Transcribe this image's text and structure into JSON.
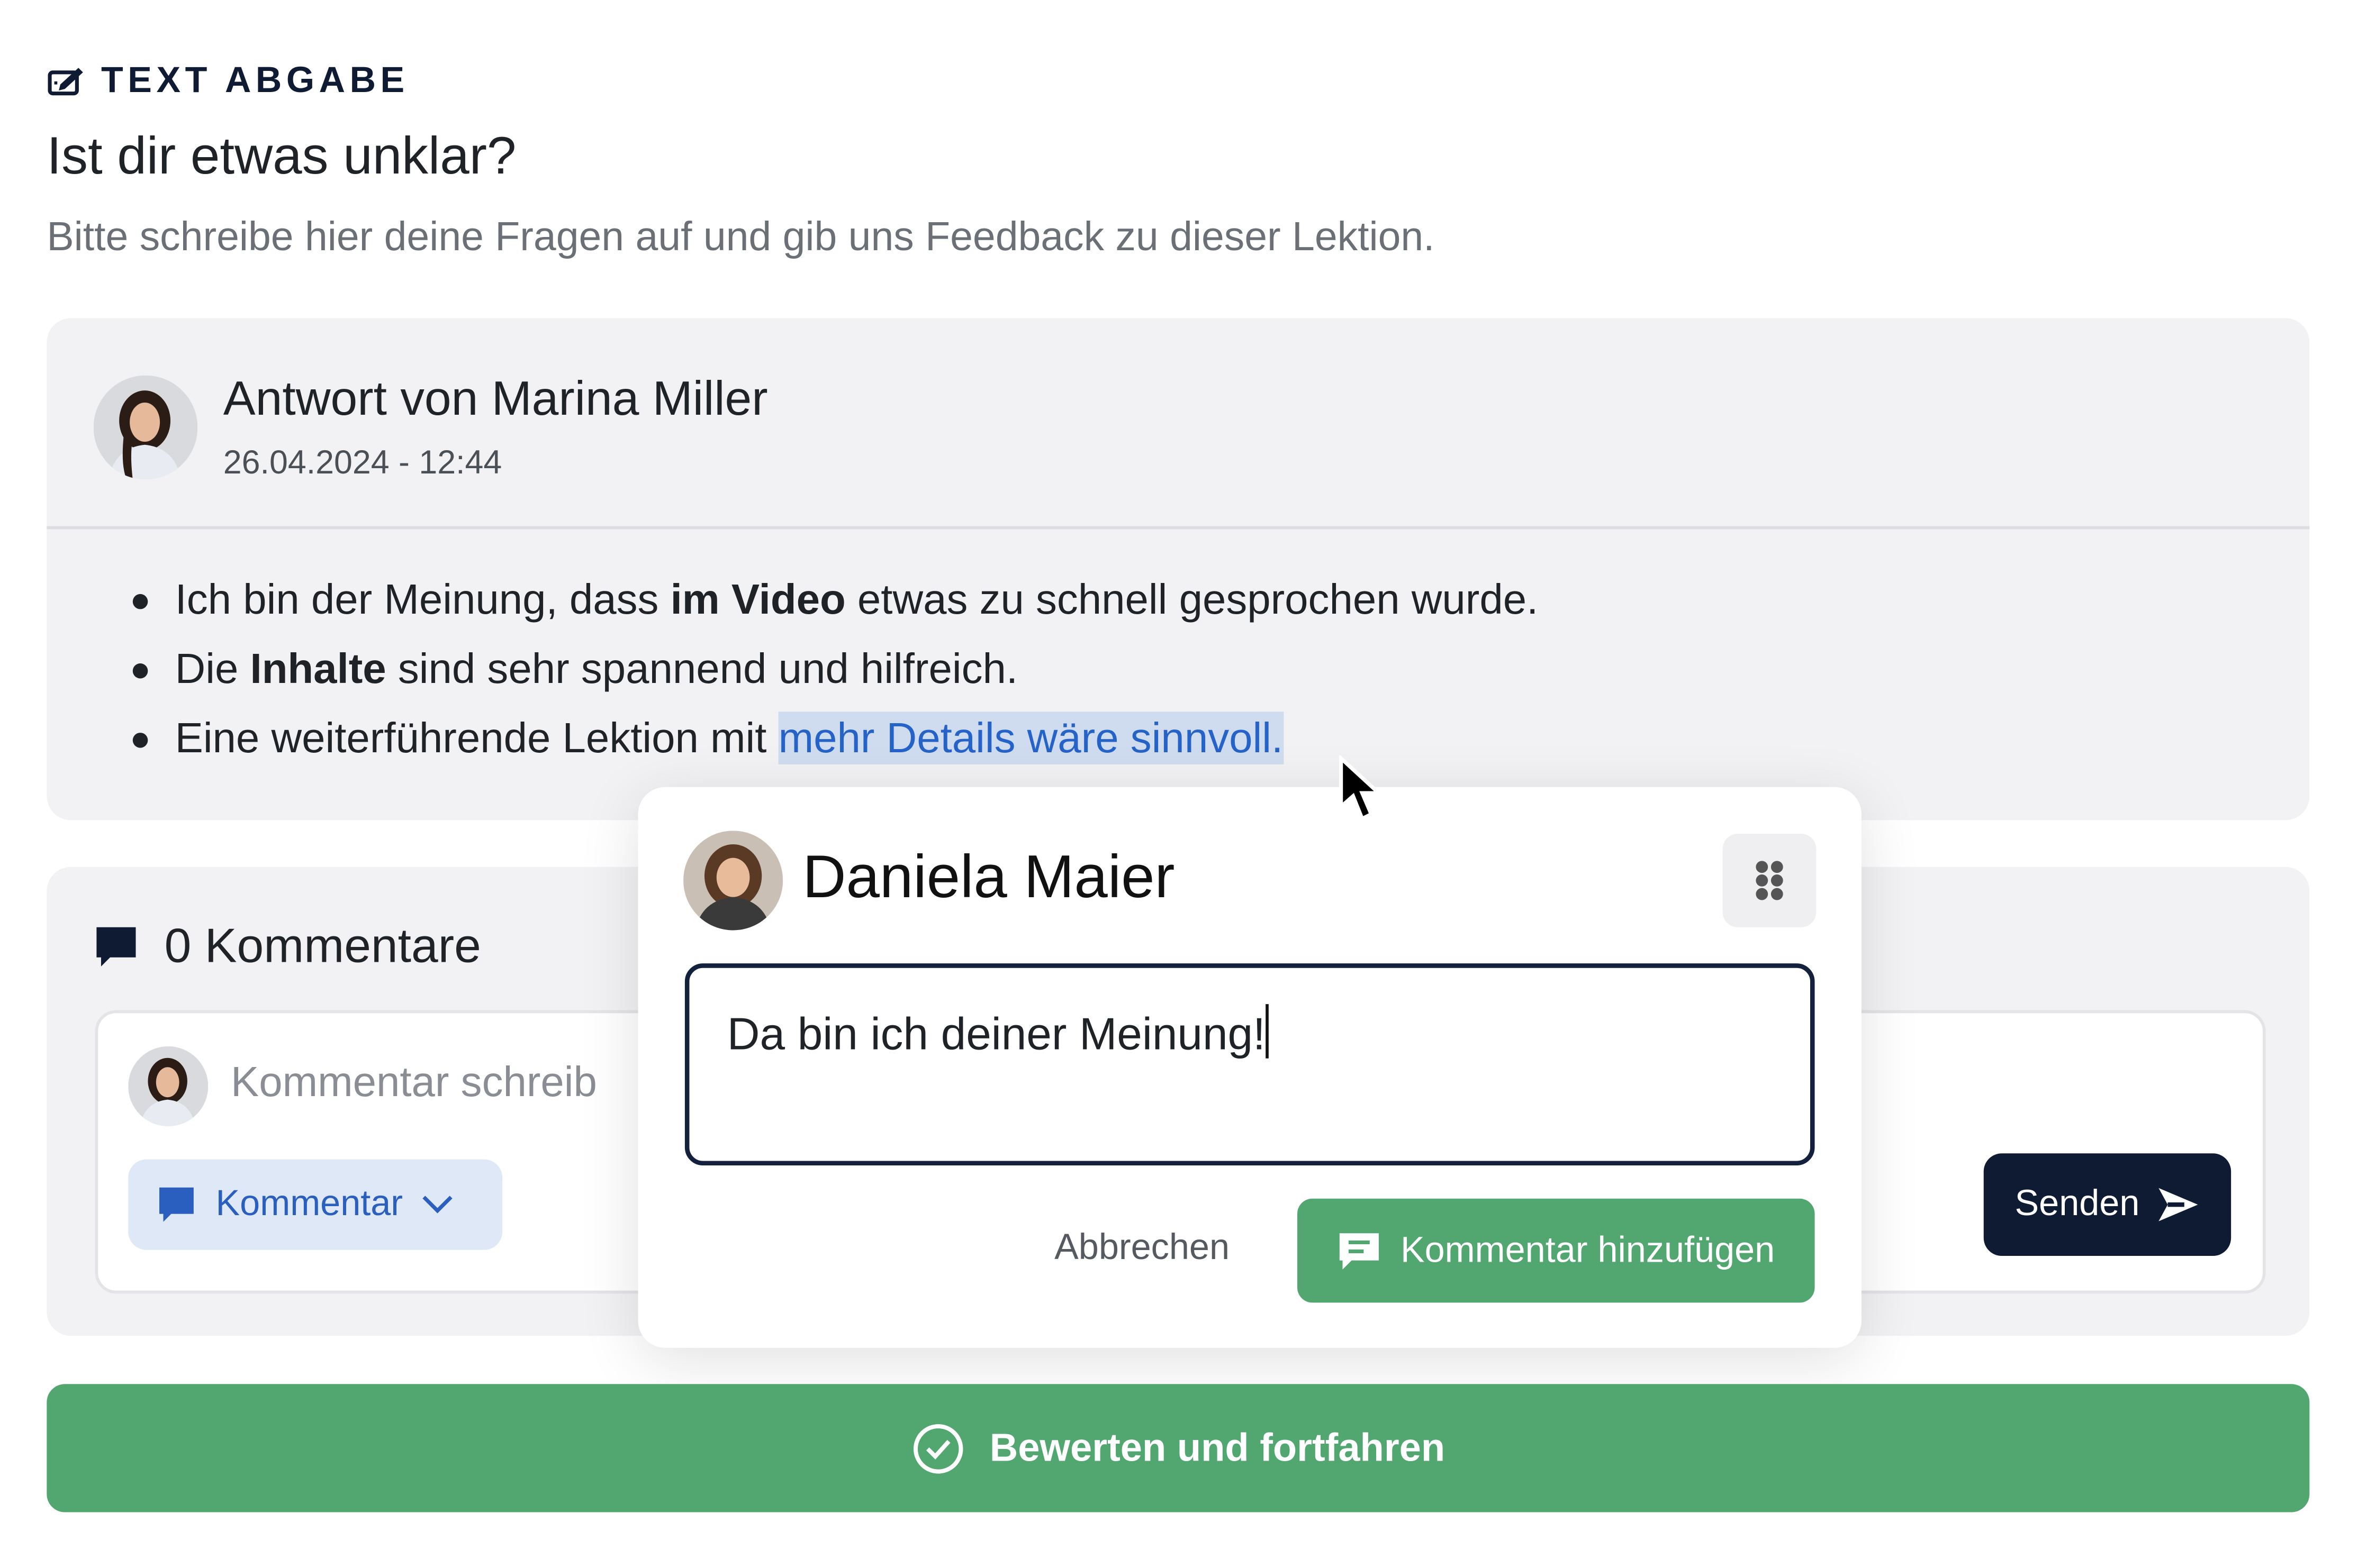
{
  "section": {
    "label": "TEXT ABGABE",
    "icon": "edit-text-icon"
  },
  "header": {
    "title": "Ist dir etwas unklar?",
    "subtitle": "Bitte schreibe hier deine Fragen auf und gib uns Feedback zu dieser Lektion."
  },
  "answer": {
    "author": "Antwort von Marina Miller",
    "date": "26.04.2024 - 12:44",
    "bullets": [
      {
        "pre": "Ich bin der Meinung, dass ",
        "bold": "im Video",
        "post": " etwas zu schnell gesprochen wurde."
      },
      {
        "pre": "Die ",
        "bold": "Inhalte",
        "post": " sind sehr spannend und hilfreich."
      },
      {
        "pre": "Eine weiterführende Lektion mit ",
        "highlight": "mehr Details wäre sinnvoll."
      }
    ]
  },
  "comments": {
    "title": "0 Kommentare",
    "placeholder": "Kommentar schreib",
    "type_label": "Kommentar",
    "send_label": "Senden"
  },
  "popup": {
    "user": "Daniela Maier",
    "input_value": "Da bin ich deiner Meinung!",
    "cancel_label": "Abbrechen",
    "add_label": "Kommentar hinzufügen"
  },
  "submit": {
    "label": "Bewerten und fortfahren"
  },
  "colors": {
    "navy": "#0f1b33",
    "green": "#52a66f",
    "blue": "#2563c9",
    "highlight_bg": "#cfdcf0",
    "card_bg": "#f2f2f4"
  }
}
